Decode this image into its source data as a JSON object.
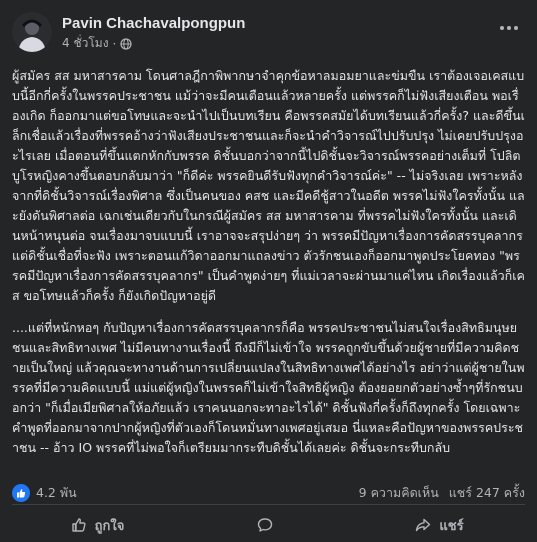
{
  "post": {
    "author": "Pavin Chachavalpongpun",
    "time": "4 ชั่วโมง",
    "audience_icon": "globe-icon",
    "paragraphs": [
      "ผู้สมัคร สส มหาสารคาม โดนศาลฎีกาพิพากษาจำคุกข้อหาลมอมยาและข่มขืน เราต้องเจอเคสแบบนี้อีกกี่ครั้งในพรรคประชาชน แม้ว่าจะมีคนเตือนแล้วหลายครั้ง แต่พรรคก็ไม่ฟังเสียงเตือน พอเรื่องเกิด ก็ออกมาแต่ขอโทษและจะนำไปเป็นบทเรียน คือพรรคสมัยได้บทเรียนแล้วกี่ครั้ง? และดีขึ้นเล็กเชื่อแล้วเรื่องที่พรรคอ้างว่าฟังเสียงประชาชนและก็จะนำคำวิจารณ์ไปปรับปรุง ไม่เคยปรับปรุงอะไรเลย เมื่อตอนที่ขึ้นแตกหักกับพรรค ดิชั้นบอกว่าจากนี้ไปดิชั้นจะวิจารณ์พรรคอย่างเต็มที่ โปลิตบูโรหญิงคางขึ้นตอบกลับมาว่า \"ก็ดีค่ะ พรรคยินดีรับฟังทุกคำวิจารณ์ค่ะ\" -- ไม่จริงเลย เพราะหลังจากที่ดิชั้นวิจารณ์เรื่องพิศาล ซึ่งเป็นคนของ คสช และมีคดีชู้สาวในอดีต พรรคไม่ฟังใครทั้งนั้น และยังดันพิศาลต่อ เฉกเช่นเดียวกับในกรณีผู้สมัคร สส มหาสารคาม ที่พรรคไม่ฟังใครทั้งนั้น และเดินหน้าหนุนต่อ จนเรื่องมาจบแบบนี้ เราอาจจะสรุปง่ายๆ ว่า พรรคมีปัญหาเรื่องการคัดสรรบุคลากร แต่ดิชั้นเชื่อที่จะฟัง เพราะตอนแก้วิดาออกมาแถลงข่าว ตัวรักชนเองก็ออกมาพูดประโยคทอง \"พรรคมีปัญหาเรื่องการคัดสรรบุคลากร\" เป็นคำพูดง่ายๆ ที่แม่เวลาจะผ่านมาแค่ไหน เกิดเรื่องแล้วก็เคส ขอโทษแล้วก็ครั้ง ก็ยังเกิดปัญหาอยู่ดี",
      "....แต่ที่หนักหอๆ กับปัญหาเรื่องการคัดสรรบุคลากรก็คือ พรรคประชาชนไม่สนใจเรื่องสิทธิมนุษยชนและสิทธิทางเพศ ไม่มีคนทางานเรื่องนี้ ถึงมีก็ไม่เข้าใจ พรรคถูกขับขึ้นด้วยผู้ชายที่มีความคิดชายเป็นใหญ่ แล้วคุณจะทางานด้านการเปลี่ยนแปลงในสิทธิทางเพศได้อย่างไร อย่าว่าแต่ผู้ชายในพรรคที่มีความคิดแบบนี้ แม่แต่ผู้หญิงในพรรคก็ไม่เข้าใจสิทธิผู้หญิง ต้องยอยกตัวอย่างซ้ำๆที่รักชนบอกว่า \"ก็เมื่อเมียพิศาลให้อภัยแล้ว เราคนนอกจะทาอะไรได้\" ดิชั้นฟังกี่ครั้งก็ถึงทุกครั้ง โดยเฉพาะคำพูดที่ออกมาจากปากผู้หญิงที่ตัวเองก็โดนหมั่นทางเพศอยู่เสมอ นี่แหละคือปัญหาของพรรคประชาชน -- อ้าว IO พรรคที่ไม่พอใจก็เตรียมมากระทืบดิชั้นได้เลยค่ะ ดิชั้นจะกระทืบกลับ"
    ]
  },
  "stats": {
    "reactions_count": "4.2 พัน",
    "comments": "9 ความคิดเห็น",
    "shares": "แชร์ 247 ครั้ง"
  },
  "actions": {
    "like_label": "ถูกใจ",
    "comment_label": "",
    "share_label": "แชร์"
  },
  "colors": {
    "background": "#242526",
    "text": "#e4e6eb",
    "secondary": "#b0b3b8",
    "like_blue": "#2078f4"
  }
}
